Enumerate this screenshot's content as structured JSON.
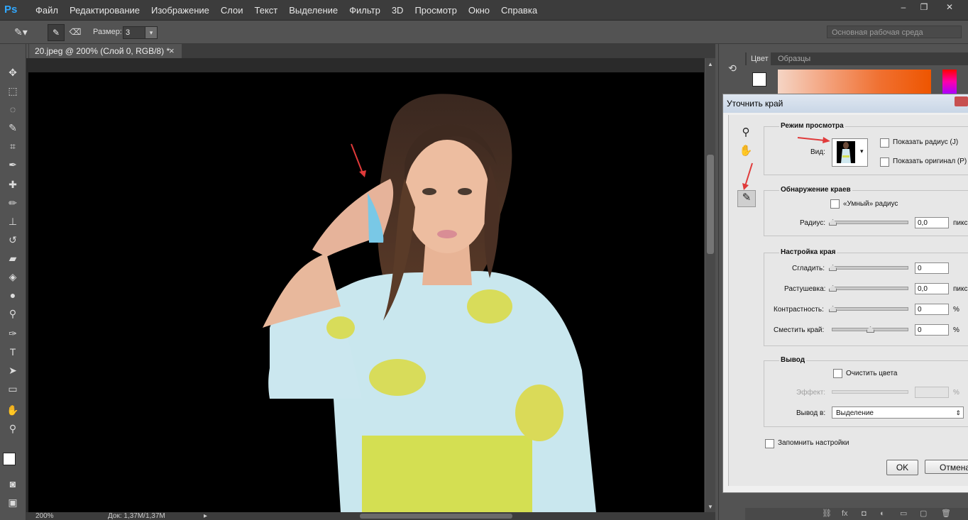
{
  "app": {
    "logo": "Ps"
  },
  "menubar": {
    "items": [
      "Файл",
      "Редактирование",
      "Изображение",
      "Слои",
      "Текст",
      "Выделение",
      "Фильтр",
      "3D",
      "Просмотр",
      "Окно",
      "Справка"
    ]
  },
  "window_controls": {
    "minimize": "–",
    "restore": "❐",
    "close": "✕"
  },
  "options_bar": {
    "size_label": "Размер:",
    "size_value": "3",
    "workspace": "Основная рабочая среда"
  },
  "document": {
    "tab_title": "20.jpeg @ 200% (Слой 0, RGB/8) *",
    "tab_close": "×"
  },
  "status_bar": {
    "zoom": "200%",
    "doc_info": "Док: 1,37M/1,37M"
  },
  "panel": {
    "tabs": [
      "Цвет",
      "Образцы"
    ]
  },
  "dialog": {
    "title": "Уточнить край",
    "view_mode": {
      "heading": "Режим просмотра",
      "view_label": "Вид:",
      "show_radius": "Показать радиус (J)",
      "show_original": "Показать оригинал (P)"
    },
    "edge_detection": {
      "heading": "Обнаружение краев",
      "smart_radius": "«Умный» радиус",
      "radius_label": "Радиус:",
      "radius_value": "0,0",
      "radius_unit": "пикс"
    },
    "adjust_edge": {
      "heading": "Настройка края",
      "smooth_label": "Сгладить:",
      "smooth_value": "0",
      "feather_label": "Растушевка:",
      "feather_value": "0,0",
      "feather_unit": "пикс",
      "contrast_label": "Контрастность:",
      "contrast_value": "0",
      "contrast_unit": "%",
      "shift_label": "Сместить край:",
      "shift_value": "0",
      "shift_unit": "%"
    },
    "output": {
      "heading": "Вывод",
      "decontaminate": "Очистить цвета",
      "amount_label": "Эффект:",
      "amount_unit": "%",
      "output_to_label": "Вывод в:",
      "output_to_value": "Выделение"
    },
    "remember": "Запомнить настройки",
    "ok": "OK",
    "cancel": "Отмена"
  },
  "colors": {
    "accent": "#31a8ff",
    "annotation_arrow": "#e03a3a"
  }
}
